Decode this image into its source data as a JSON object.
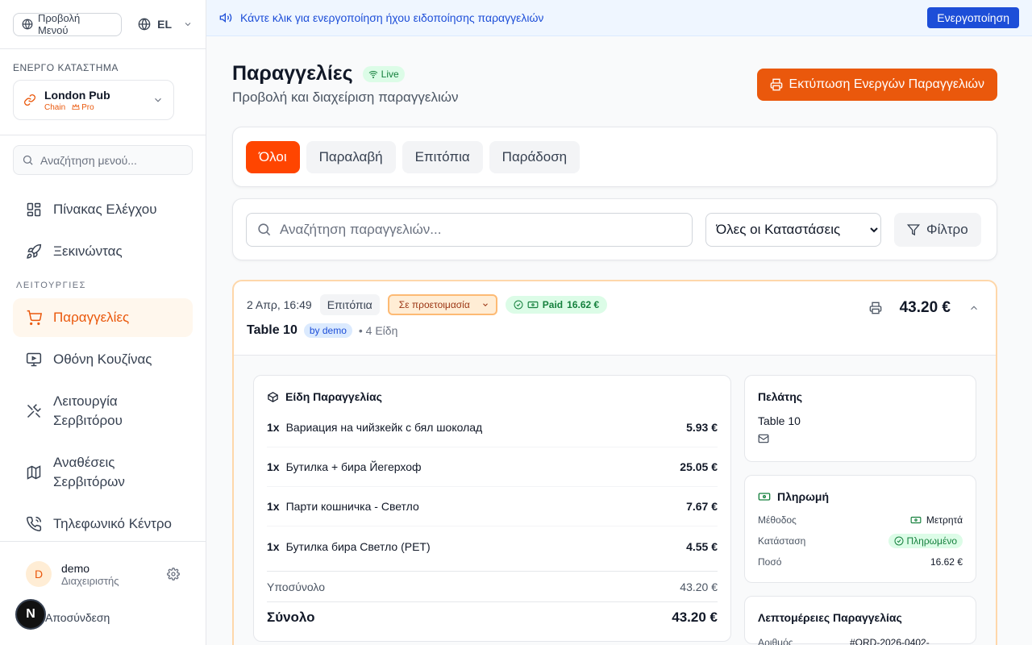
{
  "sidebar": {
    "menu_view_label": "Προβολή Μενού",
    "language": "EL",
    "active_store_label": "ΕΝΕΡΓΟ ΚΑΤΑΣΤΗΜΑ",
    "store_name": "London Pub",
    "store_type": "Chain",
    "store_plan": "Pro",
    "search_placeholder": "Αναζήτηση μενού...",
    "nav_top": [
      {
        "label": "Πίνακας Ελέγχου",
        "icon": "dashboard-icon"
      },
      {
        "label": "Ξεκινώντας",
        "icon": "rocket-icon"
      }
    ],
    "section_label": "ΛΕΙΤΟΥΡΓΙΕΣ",
    "nav_ops": [
      {
        "label": "Παραγγελίες",
        "icon": "cart-icon",
        "active": true
      },
      {
        "label": "Οθόνη Κουζίνας",
        "icon": "monitor-icon"
      },
      {
        "label": "Λειτουργία Σερβιτόρου",
        "icon": "utensils-icon"
      },
      {
        "label": "Αναθέσεις Σερβιτόρων",
        "icon": "map-icon"
      },
      {
        "label": "Τηλεφωνικό Κέντρο",
        "icon": "phone-icon"
      }
    ],
    "user_initial": "D",
    "user_name": "demo",
    "user_role": "Διαχειριστής",
    "logout_label": "Αποσύνδεση",
    "badge_letter": "N"
  },
  "banner": {
    "text": "Κάντε κλικ για ενεργοποίηση ήχου ειδοποίησης παραγγελιών",
    "button": "Ενεργοποίηση"
  },
  "header": {
    "title": "Παραγγελίες",
    "live": "Live",
    "subtitle": "Προβολή και διαχείριση παραγγελιών",
    "print_button": "Εκτύπωση Ενεργών Παραγγελιών"
  },
  "tabs": [
    "Όλοι",
    "Παραλαβή",
    "Επιτόπια",
    "Παράδοση"
  ],
  "filters": {
    "search_placeholder": "Αναζήτηση παραγγελιών...",
    "status_selected": "Όλες οι Καταστάσεις",
    "filter_button": "Φίλτρο"
  },
  "order": {
    "time": "2 Απρ, 16:49",
    "type": "Επιτόπια",
    "status": "Σε προετοιμασία",
    "paid_label": "Paid",
    "paid_amount": "16.62 €",
    "table": "Table 10",
    "by": "by demo",
    "item_count": "• 4 Είδη",
    "total": "43.20 €",
    "items_title": "Είδη Παραγγελίας",
    "items": [
      {
        "qty": "1x",
        "name": "Вариация на чийзкейк с бял шоколад",
        "price": "5.93 €"
      },
      {
        "qty": "1x",
        "name": "Бутилка + бира Йегерхоф",
        "price": "25.05 €"
      },
      {
        "qty": "1x",
        "name": "Парти кошничка - Светло",
        "price": "7.67 €"
      },
      {
        "qty": "1x",
        "name": "Бутилка бира Светло (PET)",
        "price": "4.55 €"
      }
    ],
    "subtotal_label": "Υποσύνολο",
    "subtotal": "43.20 €",
    "total_label": "Σύνολο",
    "customer_title": "Πελάτης",
    "customer_name": "Table 10",
    "payment_title": "Πληρωμή",
    "method_label": "Μέθοδος",
    "method_value": "Μετρητά",
    "status_label": "Κατάσταση",
    "status_value": "Πληρωμένο",
    "amount_label": "Ποσό",
    "amount_value": "16.62 €",
    "details_title": "Λεπτομέρειες Παραγγελίας",
    "number_label": "Αριθμός",
    "number_value": "#ORD-2026-0402-"
  },
  "colors": {
    "accent": "#ea580c",
    "tab_active": "#ff4500",
    "banner_button": "#1d4ed8",
    "success": "#15803d"
  }
}
